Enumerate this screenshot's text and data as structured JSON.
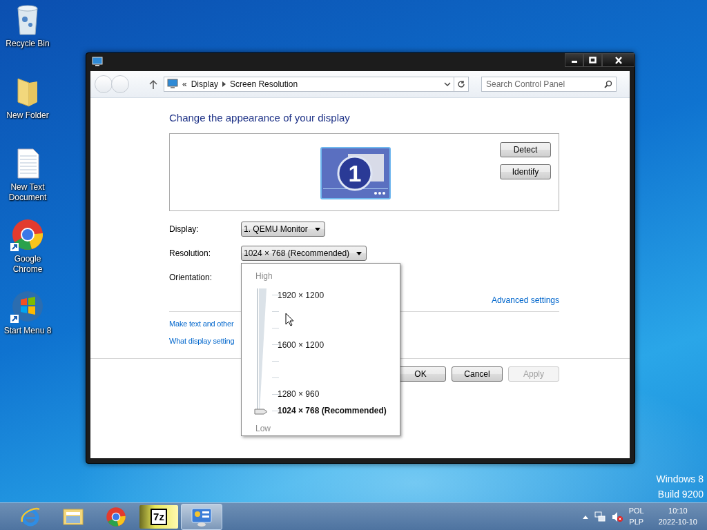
{
  "desktop": {
    "icons": [
      {
        "label": "Recycle Bin",
        "kind": "recycle",
        "shortcut": false
      },
      {
        "label": "New Folder",
        "kind": "folder",
        "shortcut": false
      },
      {
        "label": "New Text Document",
        "kind": "text",
        "shortcut": false
      },
      {
        "label": "Google Chrome",
        "kind": "chrome",
        "shortcut": true
      },
      {
        "label": "Start Menu 8",
        "kind": "windows",
        "shortcut": true
      }
    ],
    "os_label": [
      "Windows 8",
      "Build 9200"
    ]
  },
  "window": {
    "address": {
      "prefix": "«",
      "crumbs": [
        "Display",
        "Screen Resolution"
      ]
    },
    "search": {
      "placeholder": "Search Control Panel"
    },
    "heading": "Change the appearance of your display",
    "monitor": {
      "label": "1"
    },
    "monitor_buttons": [
      "Detect",
      "Identify"
    ],
    "fields": [
      {
        "label": "Display:",
        "value": "1. QEMU Monitor"
      },
      {
        "label": "Resolution:",
        "value": "1024 × 768 (Recommended)"
      },
      {
        "label": "Orientation:"
      }
    ],
    "advanced_link": "Advanced settings",
    "links": [
      "Make text and other",
      "What display setting"
    ],
    "actions": [
      {
        "label": "OK",
        "disabled": false
      },
      {
        "label": "Cancel",
        "disabled": false
      },
      {
        "label": "Apply",
        "disabled": true
      }
    ]
  },
  "resolution_popup": {
    "high": "High",
    "low": "Low",
    "level": 0,
    "stops": [
      {
        "kind": "labeled",
        "label": "1920 × 1200",
        "selected": false
      },
      {
        "kind": "tick"
      },
      {
        "kind": "tick"
      },
      {
        "kind": "labeled",
        "label": "1600 × 1200",
        "selected": false
      },
      {
        "kind": "tick"
      },
      {
        "kind": "tick"
      },
      {
        "kind": "labeled",
        "label": "1280 × 960",
        "selected": false
      },
      {
        "kind": "labeled",
        "label": "1024 × 768 (Recommended)",
        "selected": true
      }
    ]
  },
  "taskbar": {
    "apps": [
      {
        "kind": "ie",
        "active": false
      },
      {
        "kind": "explorer",
        "active": false
      },
      {
        "kind": "chrome",
        "active": false
      },
      {
        "kind": "sevenzip",
        "label": "7z",
        "active": false
      },
      {
        "kind": "control_panel",
        "active": true
      }
    ],
    "tray": {
      "language": "POL",
      "layout": "PLP",
      "time": "10:10",
      "date": "2022-10-10"
    }
  }
}
